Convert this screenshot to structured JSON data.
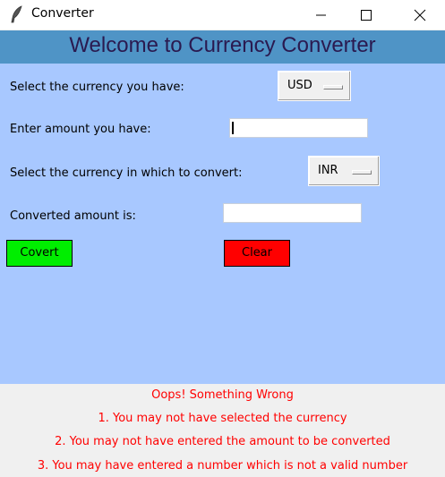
{
  "window": {
    "title": "Converter",
    "icon": "feather-icon",
    "controls": [
      "minimize-icon",
      "maximize-icon",
      "close-icon"
    ]
  },
  "header": {
    "title": "Welcome to Currency Converter"
  },
  "form": {
    "from_label": "Select the currency you have:",
    "from_currency": "USD",
    "amount_label": "Enter amount you have:",
    "amount_value": "",
    "to_label": "Select the currency in which to convert:",
    "to_currency": "INR",
    "result_label": "Converted amount is:",
    "result_value": ""
  },
  "buttons": {
    "convert_label": "Covert",
    "clear_label": "Clear"
  },
  "errors": {
    "title": "Oops! Something Wrong",
    "lines": [
      "1. You may not have selected the currency",
      "2. You may not have entered the amount to be converted",
      "3. You may have entered a number which is not a valid number"
    ]
  },
  "colors": {
    "background": "#a8c8ff",
    "header": "#4f94c6",
    "header_text": "#2a1a50",
    "convert_button": "#00ee00",
    "clear_button": "#ff0000",
    "error_text": "#ff0000"
  }
}
